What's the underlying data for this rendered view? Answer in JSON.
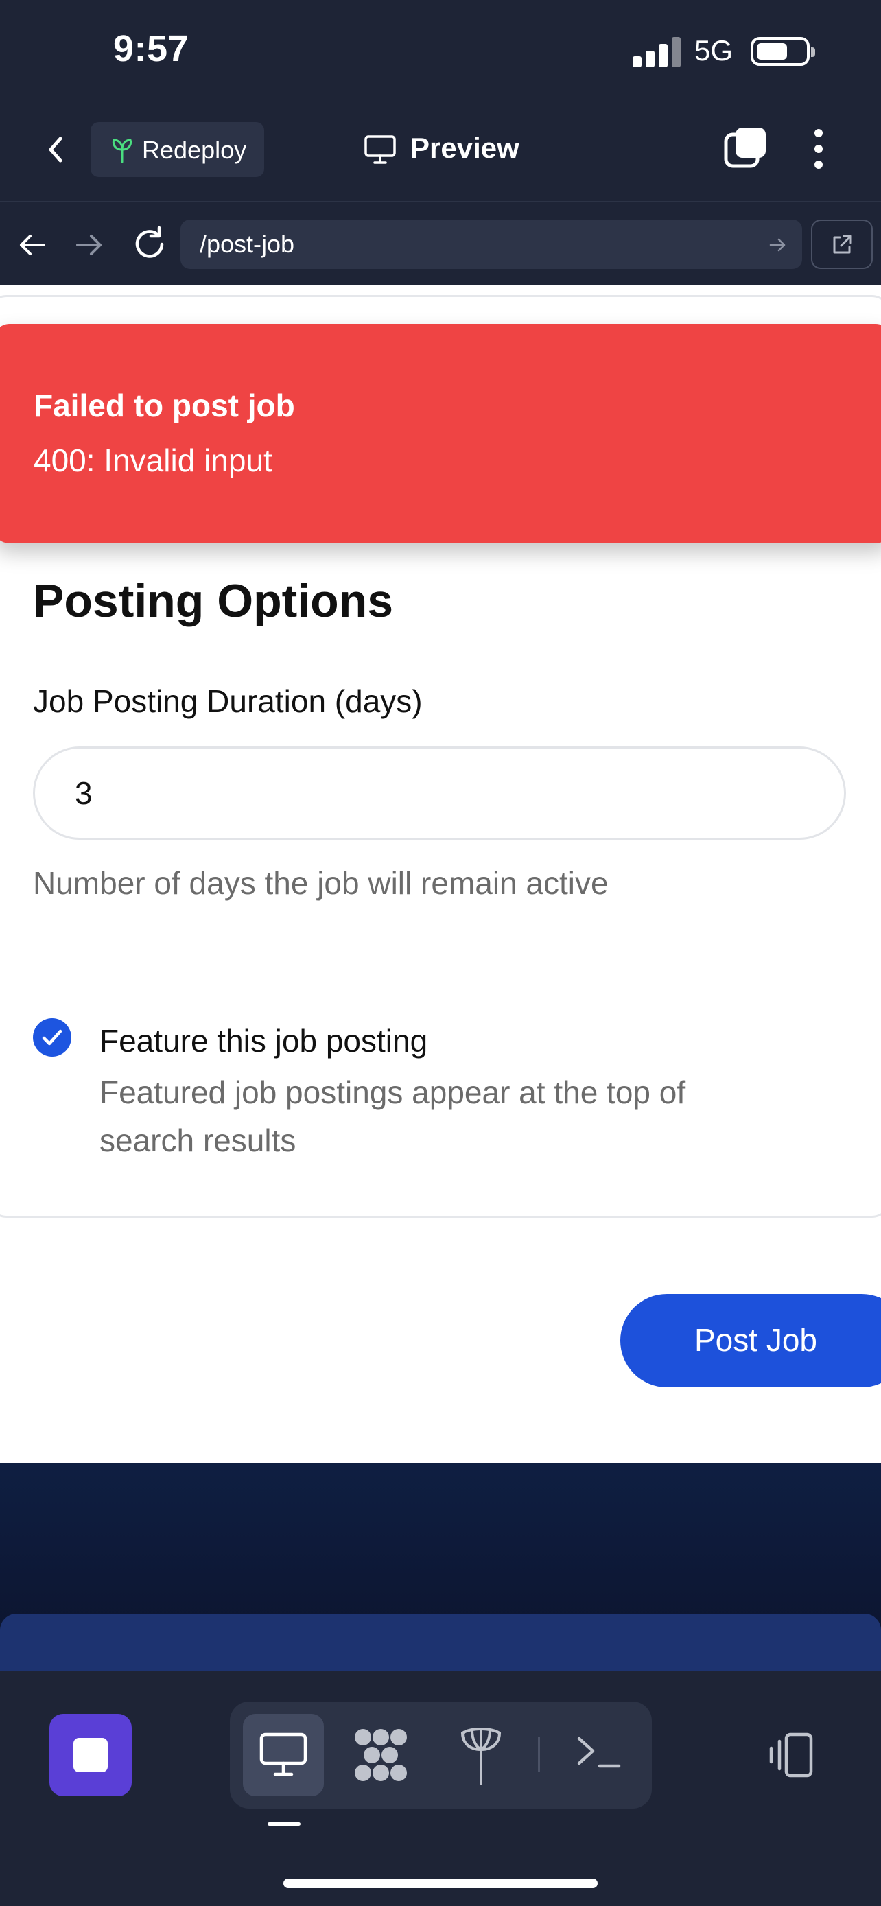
{
  "status_bar": {
    "time": "9:57",
    "network": "5G"
  },
  "toolbar": {
    "redeploy_label": "Redeploy",
    "preview_label": "Preview",
    "icons": [
      "back-chevron-icon",
      "sprout-icon",
      "monitor-icon",
      "tabs-icon",
      "more-vertical-icon"
    ]
  },
  "browser": {
    "url": "/post-job",
    "icons": [
      "arrow-left-icon",
      "arrow-right-icon",
      "reload-icon",
      "go-arrow-icon",
      "external-link-icon"
    ]
  },
  "toast": {
    "title": "Failed to post job",
    "message": "400: Invalid input",
    "color": "#ef4444"
  },
  "form": {
    "section_title": "Posting Options",
    "duration": {
      "label": "Job Posting Duration (days)",
      "value": "3",
      "help": "Number of days the job will remain active"
    },
    "feature": {
      "checked": true,
      "label": "Feature this job posting",
      "description": "Featured job postings appear at the top of search results"
    },
    "submit_label": "Post Job",
    "accent_color": "#1d51db"
  },
  "dock": {
    "items": [
      "stop-icon",
      "monitor-icon",
      "pods-icon",
      "deploy-icon",
      "terminal-icon",
      "panel-toggle-icon"
    ],
    "active": "monitor-icon"
  }
}
